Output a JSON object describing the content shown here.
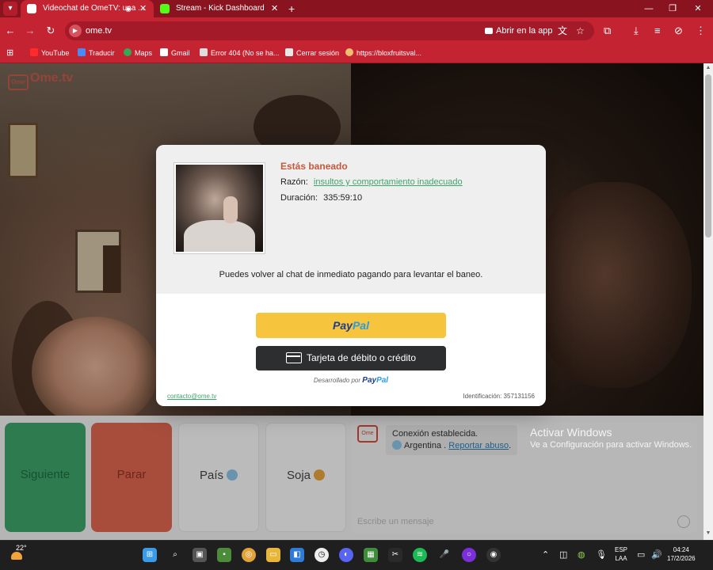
{
  "tabs": [
    {
      "title": "Videochat de OmeTV: una ...",
      "active": true
    },
    {
      "title": "Stream - Kick Dashboard",
      "active": false
    }
  ],
  "toolbar": {
    "url": "ome.tv",
    "open_in_app": "Abrir en la app"
  },
  "bookmarks": [
    "YouTube",
    "Traducir",
    "Maps",
    "Gmail",
    "Error 404 (No se ha...",
    "Cerrar sesión",
    "https://bloxfruitsval..."
  ],
  "logo": {
    "mark": "Ome",
    "text": "Ome.tv"
  },
  "ban": {
    "title": "Estás baneado",
    "reason_label": "Razón:",
    "reason_value": "insultos y comportamiento inadecuado",
    "duration_label": "Duración:",
    "duration_value": "335:59:10",
    "message": "Puedes volver al chat de inmediato pagando para levantar el baneo.",
    "paypal_a": "Pay",
    "paypal_b": "Pal",
    "card_label": "Tarjeta de débito o crédito",
    "powered_by": "Desarrollado por",
    "powered_brand_a": "Pay",
    "powered_brand_b": "Pal",
    "contact": "contacto@ome.tv",
    "identification": "Identificación: 357131156"
  },
  "controls": {
    "next": "Siguiente",
    "stop": "Parar",
    "country": "País",
    "gender": "Soja"
  },
  "chat": {
    "logo_text": "Ome",
    "connected": "Conexión establecida.",
    "country": "Argentina",
    "separator": ".",
    "report": "Reportar abuso",
    "placeholder": "Escribe un mensaje"
  },
  "watermark": {
    "line1": "Activar Windows",
    "line2": "Ve a Configuración para activar Windows."
  },
  "taskbar": {
    "temp": "22°",
    "lang1": "ESP",
    "lang2": "LAA",
    "time": "04:24",
    "date": "17/2/2026"
  },
  "colors": {
    "browser_theme": "#c42331",
    "next_button": "#3ea46a",
    "stop_button": "#e0674f",
    "paypal_yellow": "#f6c43d",
    "ban_title": "#c25a3c"
  }
}
